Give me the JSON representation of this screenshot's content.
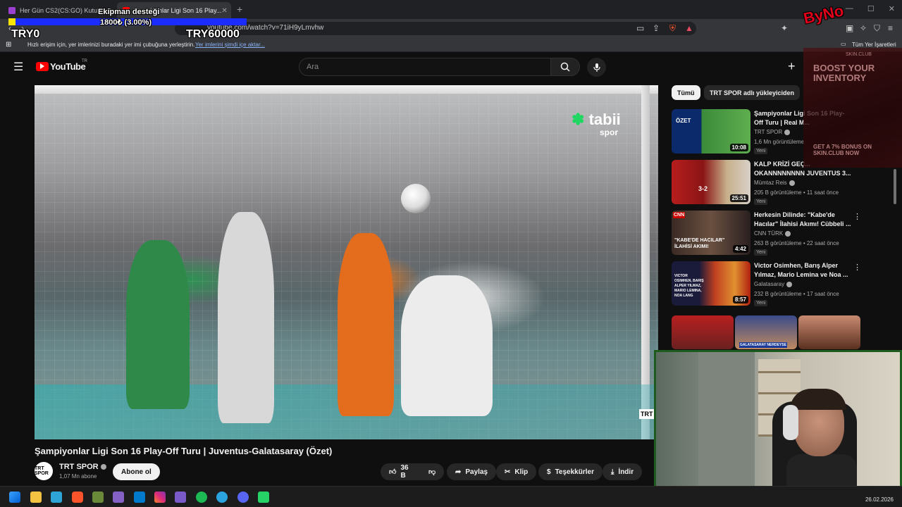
{
  "browser": {
    "tabs": [
      {
        "title": "Her Gün CS2(CS:GO) Kutuları Aç 19..."
      },
      {
        "title": "Şampiyonlar Ligi Son 16 Play..."
      }
    ],
    "new_tab": "+",
    "url": "youtube.com/watch?v=71iH9yLmvhw",
    "bookmarks_hint": "Hızlı erişim için, yer imlerinizi buradaki yer imi çubuğuna yerleştirin.",
    "bookmarks_import_link": "Yer imlerini şimdi içe aktar...",
    "all_bookmarks": "Tüm Yer İşaretleri"
  },
  "overlay": {
    "team_support_label": "Ekipman desteği",
    "progress_text": "1800₺ (3.00%)",
    "progress_value": 0.03,
    "start_label": "TRY0",
    "goal_label": "TRY60000",
    "logo_text": "ByNo"
  },
  "youtube": {
    "logo": "YouTube",
    "logo_region": "TR",
    "search_placeholder": "Ara",
    "video": {
      "watermark": "tabii",
      "watermark_sub": "spor",
      "corner_logo": "TRT",
      "title": "Şampiyonlar Ligi Son 16 Play-Off Turu | Juventus-Galatasaray (Özet)",
      "channel": "TRT SPOR",
      "channel_avatar": "TRT SPOR",
      "subscribers": "1,07 Mn abone",
      "subscribe": "Abone ol",
      "likes": "36 B",
      "share": "Paylaş",
      "clip": "Klip",
      "thanks": "Teşekkürler",
      "download": "İndir"
    },
    "chips": [
      {
        "label": "Tümü"
      },
      {
        "label": "TRT SPOR adlı yükleyiciden"
      }
    ],
    "recommendations": [
      {
        "title": "Şampiyonlar Ligi Son 16 Play-Off Turu | Real M...",
        "channel": "TRT SPOR",
        "meta": "1,6 Mn görüntüleme",
        "badge": "Yeni",
        "duration": "10:08",
        "thumb_label": "ÖZET"
      },
      {
        "title": "KALP KRİZİ GEÇ... OKANNNNNNNN JUVENTUS 3...",
        "channel": "Mümtaz Reis",
        "meta": "205 B görüntüleme • 11 saat önce",
        "badge": "Yeni",
        "duration": "25:51",
        "thumb_label": "3-2"
      },
      {
        "title": "Herkesin Dilinde: \"Kabe'de Hacılar\" İlahisi Akımı! Cübbeli ...",
        "channel": "CNN TÜRK",
        "meta": "263 B görüntüleme • 22 saat önce",
        "badge": "Yeni",
        "duration": "4:42",
        "thumb_label": "\"KABE'DE HACILAR\" İLAHİSİ AKIMI!"
      },
      {
        "title": "Victor Osimhen, Barış Alper Yılmaz, Mario Lemina ve Noa ...",
        "channel": "Galatasaray",
        "meta": "232 B görüntüleme • 17 saat önce",
        "badge": "Yeni",
        "duration": "8:57",
        "thumb_label": "VICTOR OSIMHEN, BARIŞ ALPER YILMAZ, MARIO LEMINA, NOA LANG"
      }
    ],
    "shorts_label": "GALATASARAY NERDEYSE"
  },
  "ad": {
    "headline": "BOOST YOUR INVENTORY",
    "sub": "GET A 7% BONUS ON SKIN.CLUB NOW",
    "brand": "SKIN.CLUB"
  },
  "taskbar": {
    "date": "26.02.2026"
  },
  "colors": {
    "yt_red": "#ff0000",
    "progress_blue": "#1a2cff",
    "progress_yellow": "#ffe600",
    "webcam_border": "#1e5b1e"
  }
}
